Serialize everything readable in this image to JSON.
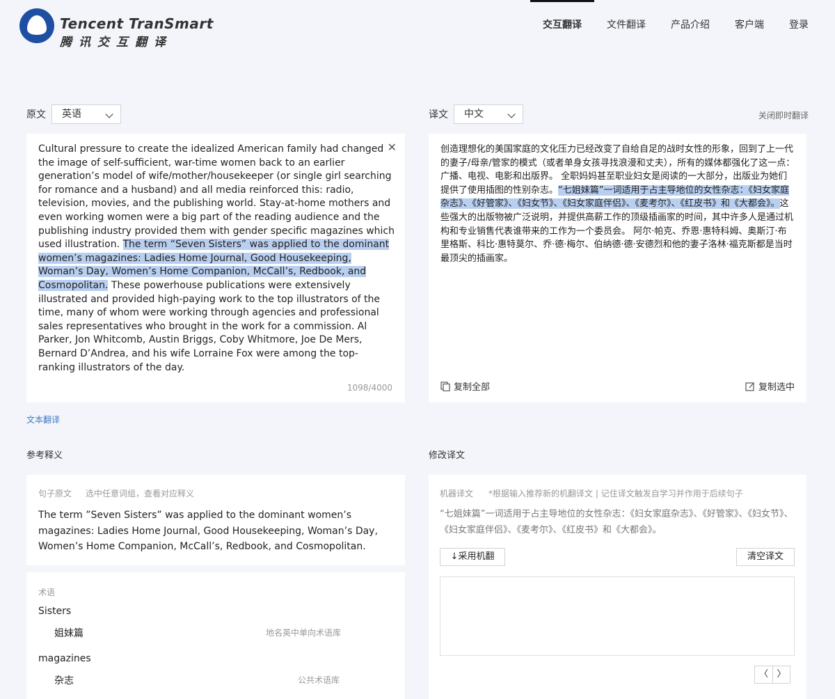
{
  "header": {
    "logo_en": "Tencent TranSmart",
    "logo_cn": "腾讯交互翻译",
    "nav": [
      "交互翻译",
      "文件翻译",
      "产品介绍",
      "客户端",
      "登录"
    ],
    "active_nav": "交互翻译"
  },
  "source": {
    "label": "原文",
    "lang": "英语",
    "text_before": "Cultural pressure to create the idealized American family had changed the image of self-sufficient, war-time women back to an earlier generation’s model of wife/mother/housekeeper (or single girl searching for romance and a husband) and all media reinforced this: radio, television, movies, and the publishing world. Stay-at-home mothers and even working women were a big part of the reading audience and the publishing industry provided them with gender specific magazines which used illustration. ",
    "text_highlight": "The term “Seven Sisters” was applied to the dominant women’s magazines: Ladies Home Journal, Good Housekeeping, Woman’s Day, Women’s Home Companion, McCall’s, Redbook, and Cosmopolitan.",
    "text_after": " These powerhouse publications were extensively illustrated and provided high-paying work to the top illustrators of the time, many of whom were working through agencies and professional sales representatives who brought in the work for a commission. Al Parker, Jon Whitcomb, Austin Briggs, Coby Whitmore, Joe De Mers, Bernard D’Andrea, and his wife Lorraine Fox were among the top-ranking illustrators of the day.",
    "counter": "1098/4000"
  },
  "target": {
    "label": "译文",
    "lang": "中文",
    "close_instant": "关闭即时翻译",
    "text_before": "创造理想化的美国家庭的文化压力已经改变了自给自足的战时女性的形象，回到了上一代的妻子/母亲/管家的模式（或者单身女孩寻找浪漫和丈夫），所有的媒体都强化了这一点：广播、电视、电影和出版界。 全职妈妈甚至职业妇女是阅读的一大部分，出版业为她们提供了使用插图的性别杂志。",
    "text_highlight": "“七姐妹篇”一词适用于占主导地位的女性杂志：《妇女家庭杂志》、《好管家》、《妇女节》、《妇女家庭伴侣》、《麦考尔》、《红皮书》和《大都会》。",
    "text_after": "这些强大的出版物被广泛说明，并提供高薪工作的顶级插画家的时间，其中许多人是通过机构和专业销售代表谁带来的工作为一个委员会。 阿尔·帕克、乔恩·惠特科姆、奥斯汀·布里格斯、科比·惠特莫尔、乔·德·梅尔、伯纳德·德·安德烈和他的妻子洛林·福克斯都是当时最顶尖的插画家。",
    "copy_all": "复制全部",
    "copy_selected": "复制选中"
  },
  "text_translation_link": "文本翻译",
  "reference": {
    "title": "参考释义",
    "head_label": "句子原文",
    "head_hint": "选中任意词组，查看对应释义",
    "sentence": "The term ”Seven Sisters” was applied to the dominant women’s magazines: Ladies Home Journal, Good Housekeeping, Woman’s Day, Women’s Home Companion, McCall’s, Redbook, and Cosmopolitan."
  },
  "terms": {
    "head": "术语",
    "items": [
      {
        "word": "Sisters",
        "translation": "姐妹篇",
        "source": "地名英中单向术语库"
      },
      {
        "word": "magazines",
        "translation": "杂志",
        "source": "公共术语库"
      }
    ]
  },
  "edit": {
    "title": "修改译文",
    "head_label": "机器译文",
    "head_hint": "*根据输入推荐新的机翻译文 | 记住译文触发自学习并作用于后续句子",
    "machine_text": "“七姐妹篇”一词适用于占主导地位的女性杂志：《妇女家庭杂志》、《好管家》、《妇女节》、《妇女家庭伴侣》、《麦考尔》、《红皮书》和《大都会》。",
    "adopt_button": "↓采用机翻",
    "clear_button": "清空译文",
    "prev": "〈",
    "next": "〉"
  }
}
